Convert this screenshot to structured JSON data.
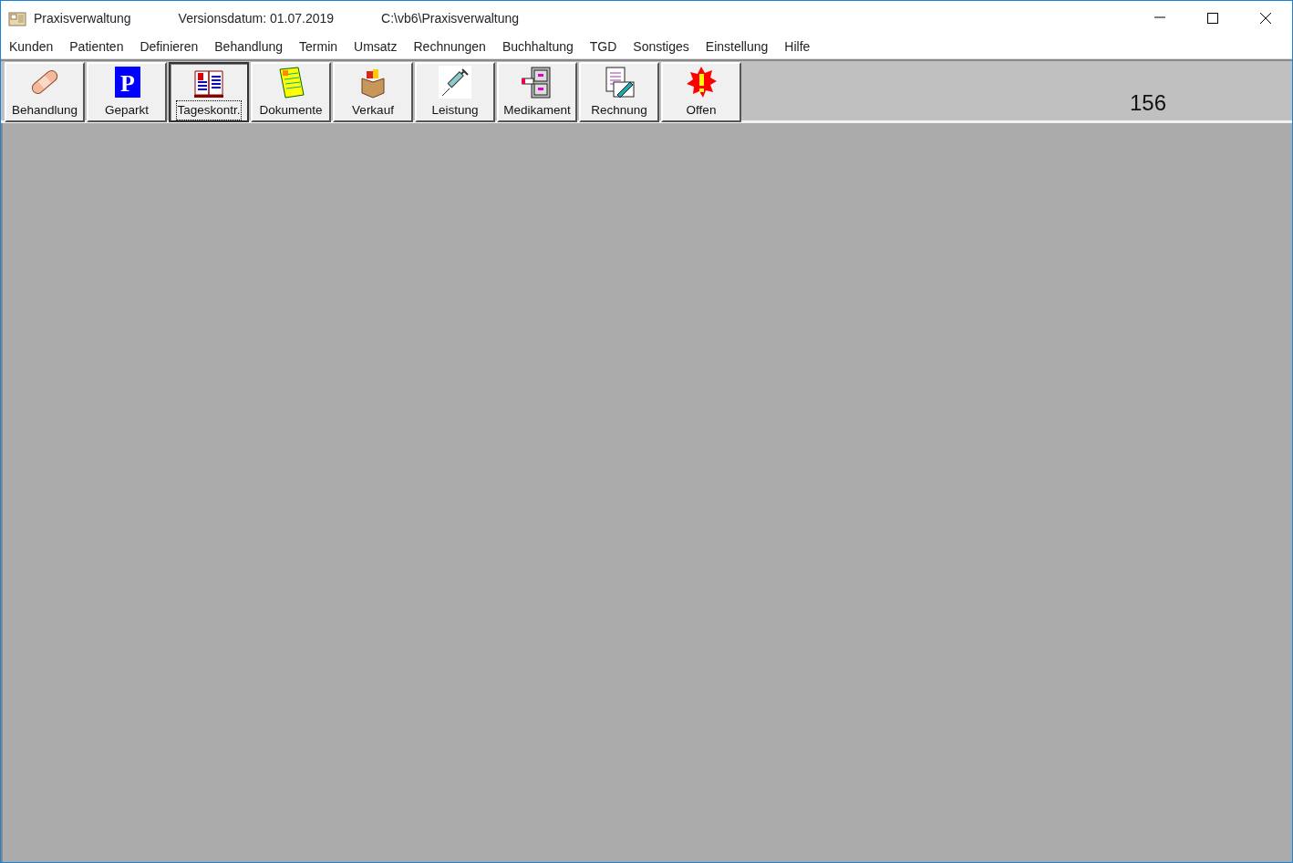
{
  "window": {
    "title": "Praxisverwaltung",
    "version": "Versionsdatum: 01.07.2019",
    "path": "C:\\vb6\\Praxisverwaltung"
  },
  "menu": [
    "Kunden",
    "Patienten",
    "Definieren",
    "Behandlung",
    "Termin",
    "Umsatz",
    "Rechnungen",
    "Buchhaltung",
    "TGD",
    "Sonstiges",
    "Einstellung",
    "Hilfe"
  ],
  "toolbar": [
    {
      "label": "Behandlung",
      "kind": "bandage",
      "selected": false
    },
    {
      "label": "Geparkt",
      "kind": "parking",
      "icon_text": "P",
      "selected": false
    },
    {
      "label": "Tageskontr.",
      "kind": "book",
      "selected": true
    },
    {
      "label": "Dokumente",
      "kind": "documents",
      "selected": false
    },
    {
      "label": "Verkauf",
      "kind": "box",
      "selected": false
    },
    {
      "label": "Leistung",
      "kind": "syringe",
      "selected": false
    },
    {
      "label": "Medikament",
      "kind": "cabinet",
      "selected": false
    },
    {
      "label": "Rechnung",
      "kind": "invoice",
      "selected": false
    },
    {
      "label": "Offen",
      "kind": "alert",
      "selected": false
    }
  ],
  "counter": "156"
}
